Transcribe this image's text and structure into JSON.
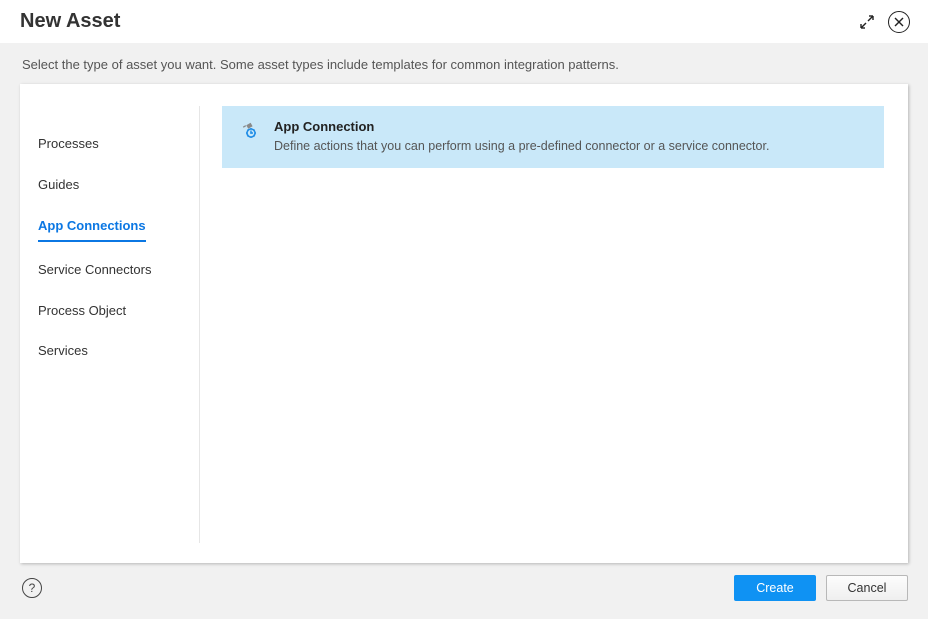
{
  "dialog": {
    "title": "New Asset",
    "instruction": "Select the type of asset you want. Some asset types include templates for common integration patterns."
  },
  "sidebar": {
    "selected_index": 2,
    "items": [
      {
        "label": "Processes"
      },
      {
        "label": "Guides"
      },
      {
        "label": "App Connections"
      },
      {
        "label": "Service Connectors"
      },
      {
        "label": "Process Object"
      },
      {
        "label": "Services"
      }
    ]
  },
  "main": {
    "card": {
      "title": "App Connection",
      "description": "Define actions that you can perform using a pre-defined connector or a service connector."
    }
  },
  "footer": {
    "help_symbol": "?",
    "create_label": "Create",
    "cancel_label": "Cancel"
  }
}
